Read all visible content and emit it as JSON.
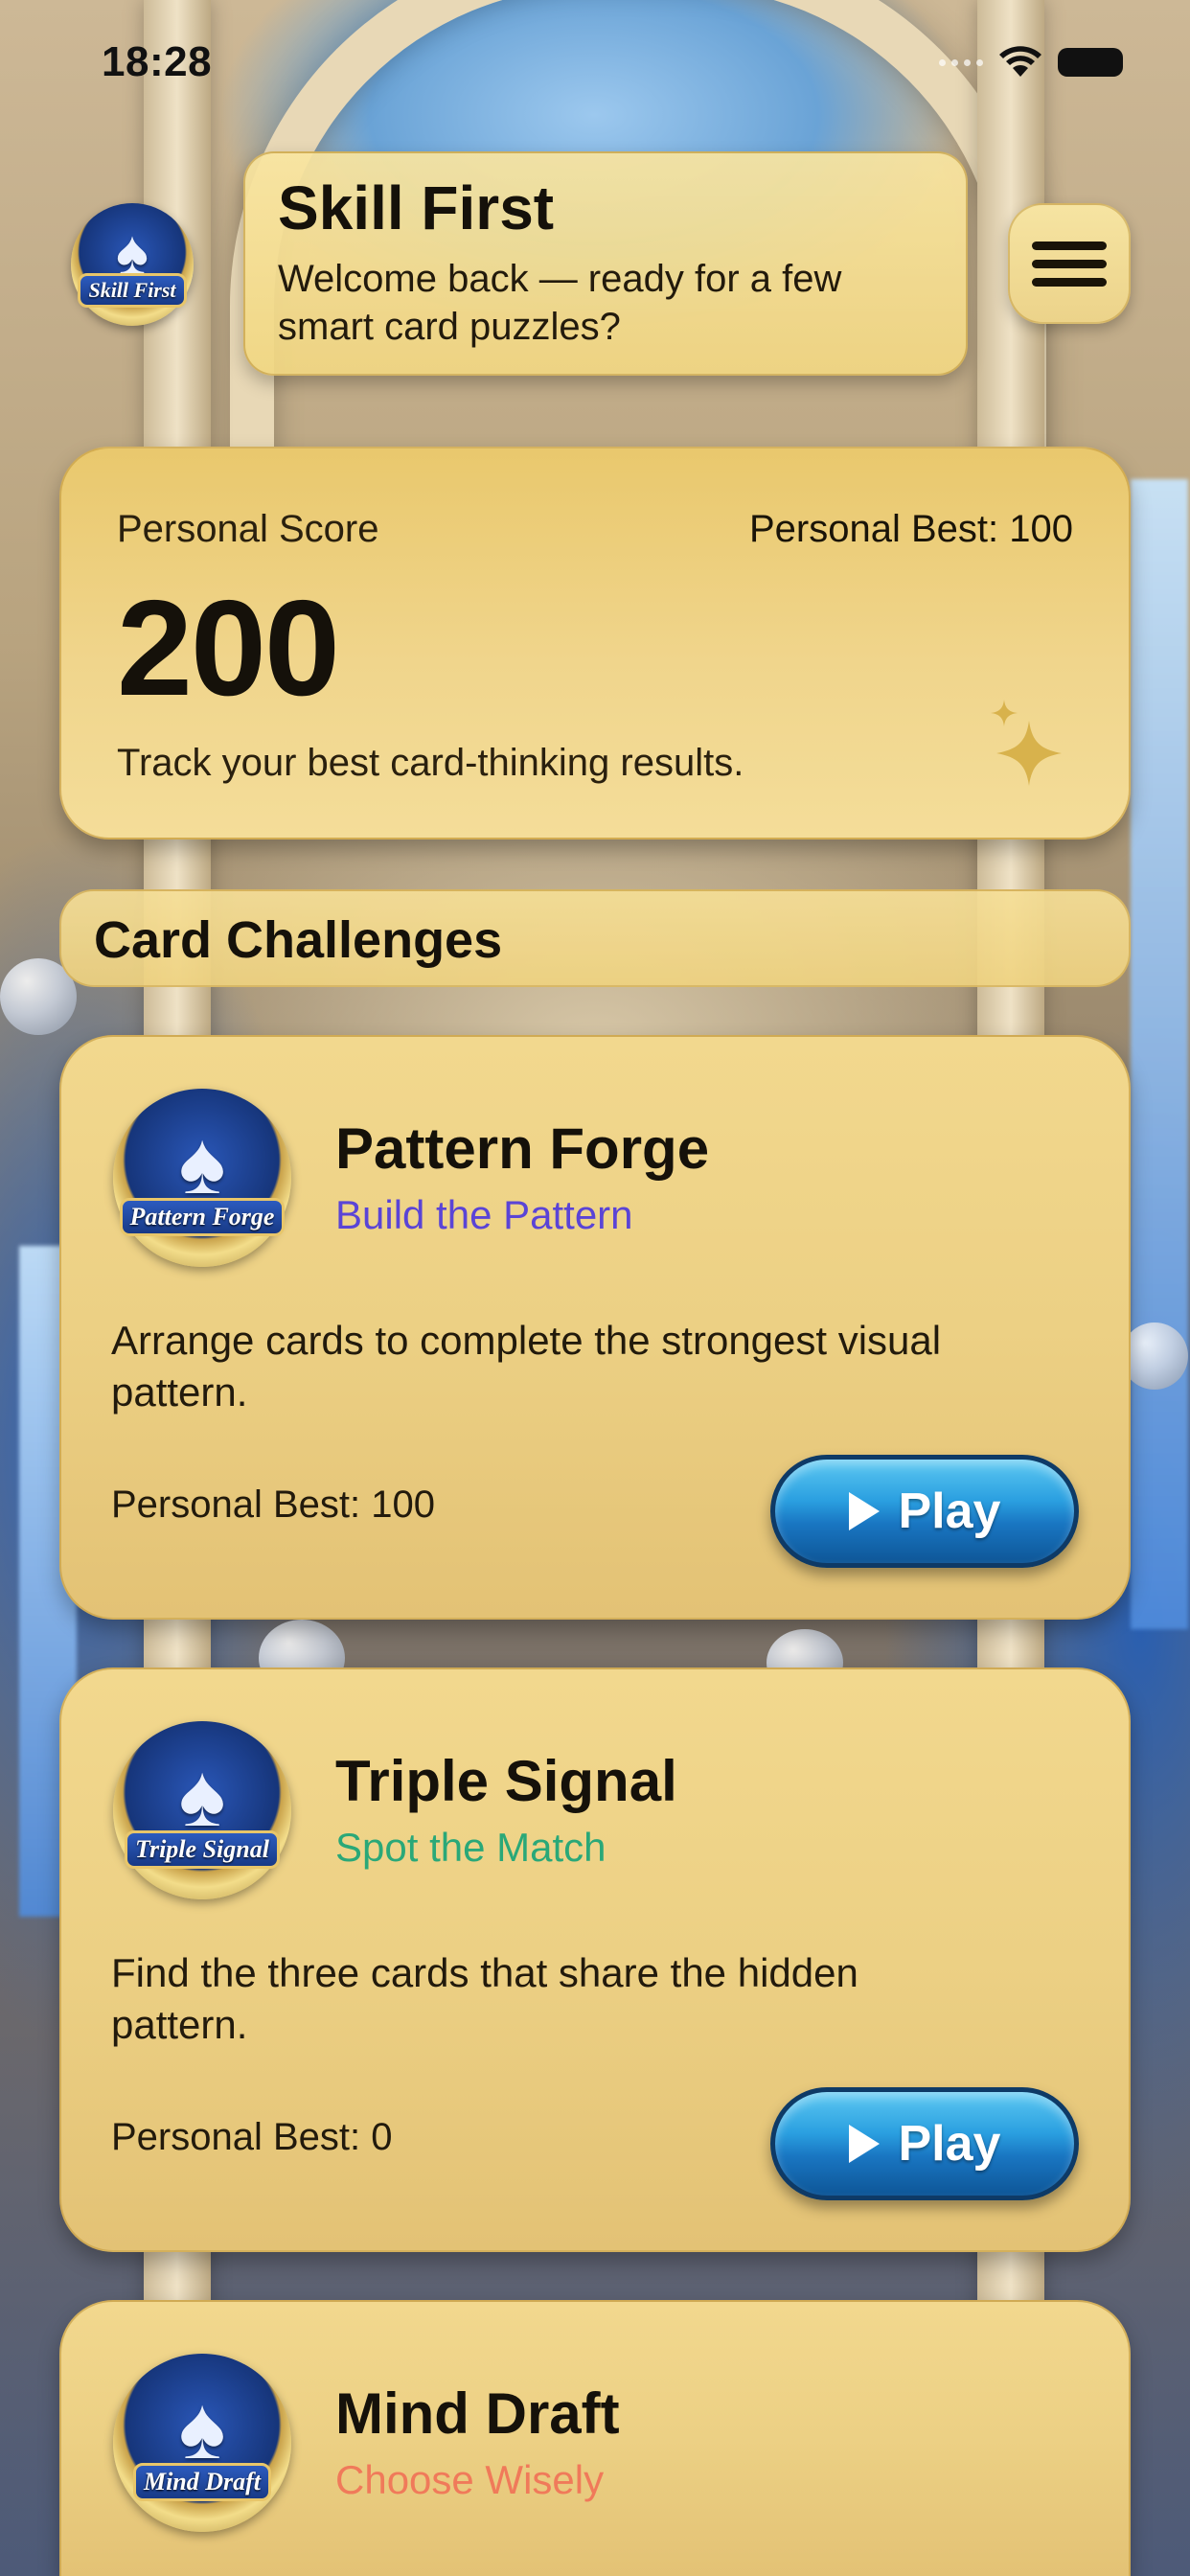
{
  "status_bar": {
    "time": "18:28"
  },
  "header": {
    "logo_text": "Skill First",
    "title": "Skill First",
    "subtitle": "Welcome back — ready for a few smart card puzzles?"
  },
  "score_card": {
    "label": "Personal Score",
    "best": "Personal Best: 100",
    "value": "200",
    "caption": "Track your best card-thinking results."
  },
  "section": {
    "title": "Card Challenges"
  },
  "games": [
    {
      "icon_text": "Pattern Forge",
      "name": "Pattern Forge",
      "tagline": "Build the Pattern",
      "tagline_color": "#5a44d6",
      "description": "Arrange cards to complete the strongest visual pattern.",
      "best": "Personal Best: 100",
      "play_label": "Play"
    },
    {
      "icon_text": "Triple Signal",
      "name": "Triple Signal",
      "tagline": "Spot the Match",
      "tagline_color": "#2aa878",
      "description": "Find the three cards that share the hidden pattern.",
      "best": "Personal Best: 0",
      "play_label": "Play"
    },
    {
      "icon_text": "Mind Draft",
      "name": "Mind Draft",
      "tagline": "Choose Wisely",
      "tagline_color": "#f07a5a"
    }
  ],
  "colors": {
    "card_gold": "#ecd084",
    "play_blue": "#2a9fe0",
    "text_dark": "#15110a"
  }
}
